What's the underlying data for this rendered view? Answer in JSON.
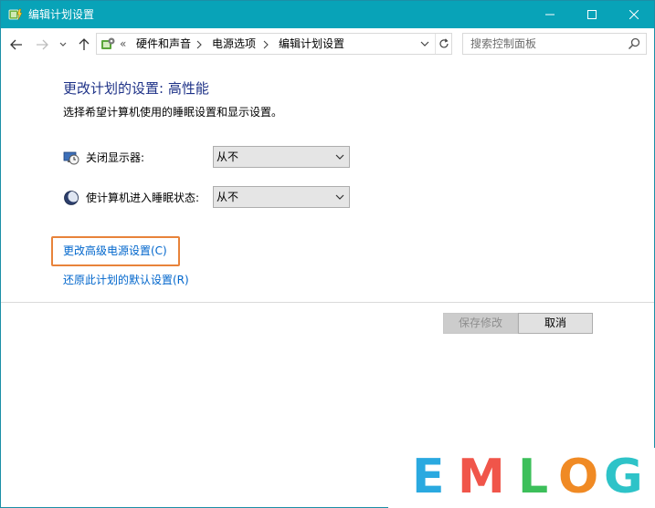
{
  "window": {
    "title": "编辑计划设置",
    "controls": {
      "minimize": "minimize",
      "maximize": "maximize",
      "close": "close"
    }
  },
  "address_bar": {
    "chevrons": "«",
    "breadcrumbs": [
      "硬件和声音",
      "电源选项",
      "编辑计划设置"
    ],
    "search_placeholder": "搜索控制面板"
  },
  "main": {
    "title": "更改计划的设置: 高性能",
    "description": "选择希望计算机使用的睡眠设置和显示设置。",
    "settings": [
      {
        "label": "关闭显示器:",
        "value": "从不",
        "icon": "display-off-icon"
      },
      {
        "label": "使计算机进入睡眠状态:",
        "value": "从不",
        "icon": "sleep-moon-icon"
      }
    ],
    "links": {
      "advanced": "更改高级电源设置(C)",
      "restore": "还原此计划的默认设置(R)"
    },
    "buttons": {
      "save": "保存修改",
      "cancel": "取消"
    }
  },
  "watermark": {
    "letters": [
      "E",
      "M",
      "L",
      "O",
      "G"
    ],
    "colors": [
      "#2aa9e0",
      "#f0554a",
      "#3cbf5a",
      "#f08a24",
      "#2ec3c8"
    ]
  },
  "colors": {
    "titlebar": "#08a3b8",
    "title_text": "#1e3287",
    "link": "#0066cc",
    "highlight_border": "#e8833a"
  }
}
